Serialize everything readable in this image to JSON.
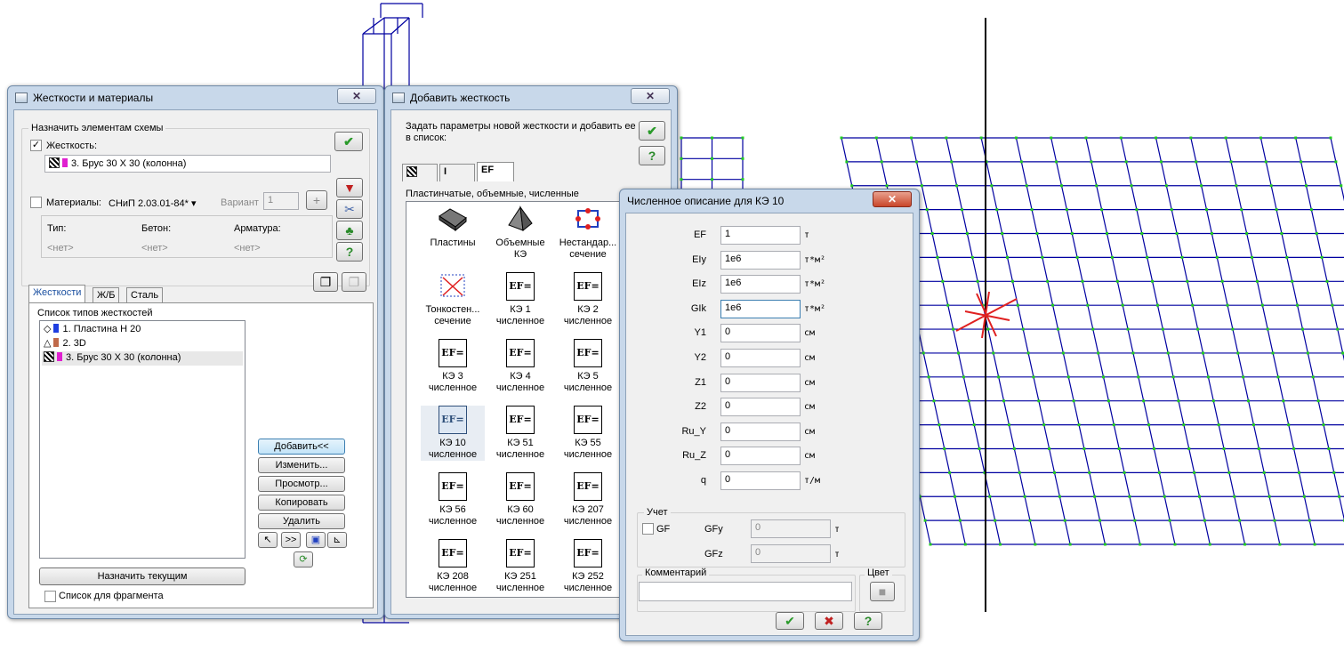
{
  "stiffness_window": {
    "title": "Жесткости и материалы",
    "close": "✕",
    "assign_group_label": "Назначить элементам схемы",
    "stiffness_checkbox_label": "Жесткость:",
    "stiffness_checked": "✓",
    "stiffness_value": "3. Брус 30 Х 30 (колонна)",
    "materials_label": "Материалы:",
    "materials_code": "СНиП 2.03.01-84*",
    "variant_label": "Вариант",
    "variant_value": "1",
    "mat_columns": [
      "Тип:",
      "Бетон:",
      "Арматура:"
    ],
    "mat_values": [
      "<нет>",
      "<нет>",
      "<нет>"
    ],
    "tabs": [
      "Жесткости",
      "Ж/Б",
      "Сталь"
    ],
    "list_label": "Список типов жесткостей",
    "list_items": [
      {
        "text": "1. Пластина  Н 20",
        "color": "#1f3fe0"
      },
      {
        "text": "2. 3D",
        "color": "#c06a4a"
      },
      {
        "text": "3. Брус 30 Х 30 (колонна)",
        "color": "#e020d0"
      }
    ],
    "buttons": [
      "Добавить<<",
      "Изменить...",
      "Просмотр...",
      "Копировать",
      "Удалить"
    ],
    "small_buttons": [
      ">>"
    ],
    "assign_current": "Назначить текущим",
    "fragment_label": "Список для фрагмента"
  },
  "add_window": {
    "title": "Добавить жесткость",
    "close": "✕",
    "instruction": "Задать параметры новой жесткости и добавить ее в список:",
    "tabs": [
      "",
      "I",
      "EF"
    ],
    "category": "Пластинчатые, объемные, численные",
    "ok": "✔",
    "help": "?",
    "items": [
      {
        "name": "plates",
        "line1": "Пластины",
        "line2": "",
        "icon": "EF"
      },
      {
        "name": "volume-fe",
        "line1": "Объемные",
        "line2": "КЭ",
        "icon": "EF"
      },
      {
        "name": "nonstandard-section",
        "line1": "Нестандар...",
        "line2": "сечение",
        "icon": "EF"
      },
      {
        "name": "thin-walled-section",
        "line1": "Тонкостен...",
        "line2": "сечение",
        "icon": "EF"
      },
      {
        "name": "fe-1",
        "line1": "КЭ 1",
        "line2": "численное",
        "icon": "EF="
      },
      {
        "name": "fe-2",
        "line1": "КЭ 2",
        "line2": "численное",
        "icon": "EF="
      },
      {
        "name": "fe-3",
        "line1": "КЭ 3",
        "line2": "численное",
        "icon": "EF="
      },
      {
        "name": "fe-4",
        "line1": "КЭ 4",
        "line2": "численное",
        "icon": "EF="
      },
      {
        "name": "fe-5",
        "line1": "КЭ 5",
        "line2": "численное",
        "icon": "EF="
      },
      {
        "name": "fe-10",
        "line1": "КЭ 10",
        "line2": "численное",
        "icon": "EF="
      },
      {
        "name": "fe-51",
        "line1": "КЭ 51",
        "line2": "численное",
        "icon": "EF="
      },
      {
        "name": "fe-55",
        "line1": "КЭ 55",
        "line2": "численное",
        "icon": "EF="
      },
      {
        "name": "fe-56",
        "line1": "КЭ 56",
        "line2": "численное",
        "icon": "EF="
      },
      {
        "name": "fe-60",
        "line1": "КЭ 60",
        "line2": "численное",
        "icon": "EF="
      },
      {
        "name": "fe-207",
        "line1": "КЭ 207",
        "line2": "численное",
        "icon": "EF="
      },
      {
        "name": "fe-208",
        "line1": "КЭ 208",
        "line2": "численное",
        "icon": "EF="
      },
      {
        "name": "fe-251",
        "line1": "КЭ 251",
        "line2": "численное",
        "icon": "EF="
      },
      {
        "name": "fe-252",
        "line1": "КЭ 252",
        "line2": "численное",
        "icon": "EF="
      }
    ]
  },
  "numeric_window": {
    "title": "Численное описание для КЭ 10",
    "close": "✕",
    "fields": [
      {
        "label": "EF",
        "value": "1",
        "unit": "т"
      },
      {
        "label": "EIy",
        "value": "1e6",
        "unit": "т*м²"
      },
      {
        "label": "EIz",
        "value": "1e6",
        "unit": "т*м²"
      },
      {
        "label": "GIk",
        "value": "1e6",
        "unit": "т*м²"
      },
      {
        "label": "Y1",
        "value": "0",
        "unit": "см"
      },
      {
        "label": "Y2",
        "value": "0",
        "unit": "см"
      },
      {
        "label": "Z1",
        "value": "0",
        "unit": "см"
      },
      {
        "label": "Z2",
        "value": "0",
        "unit": "см"
      },
      {
        "label": "Ru_Y",
        "value": "0",
        "unit": "см"
      },
      {
        "label": "Ru_Z",
        "value": "0",
        "unit": "см"
      },
      {
        "label": "q",
        "value": "0",
        "unit": "т/м"
      }
    ],
    "account_label": "Учет",
    "gf_label": "GF",
    "gfy_label": "GFy",
    "gfy_value": "0",
    "gfy_unit": "т",
    "gfz_label": "GFz",
    "gfz_value": "0",
    "gfz_unit": "т",
    "comment_label": "Комментарий",
    "color_label": "Цвет",
    "ok": "✔",
    "cancel": "✖",
    "help": "?"
  },
  "colors": {
    "grid_line": "#0000a0",
    "grid_node": "#22cc22",
    "axis": "#000000",
    "marker": "#e02020"
  }
}
